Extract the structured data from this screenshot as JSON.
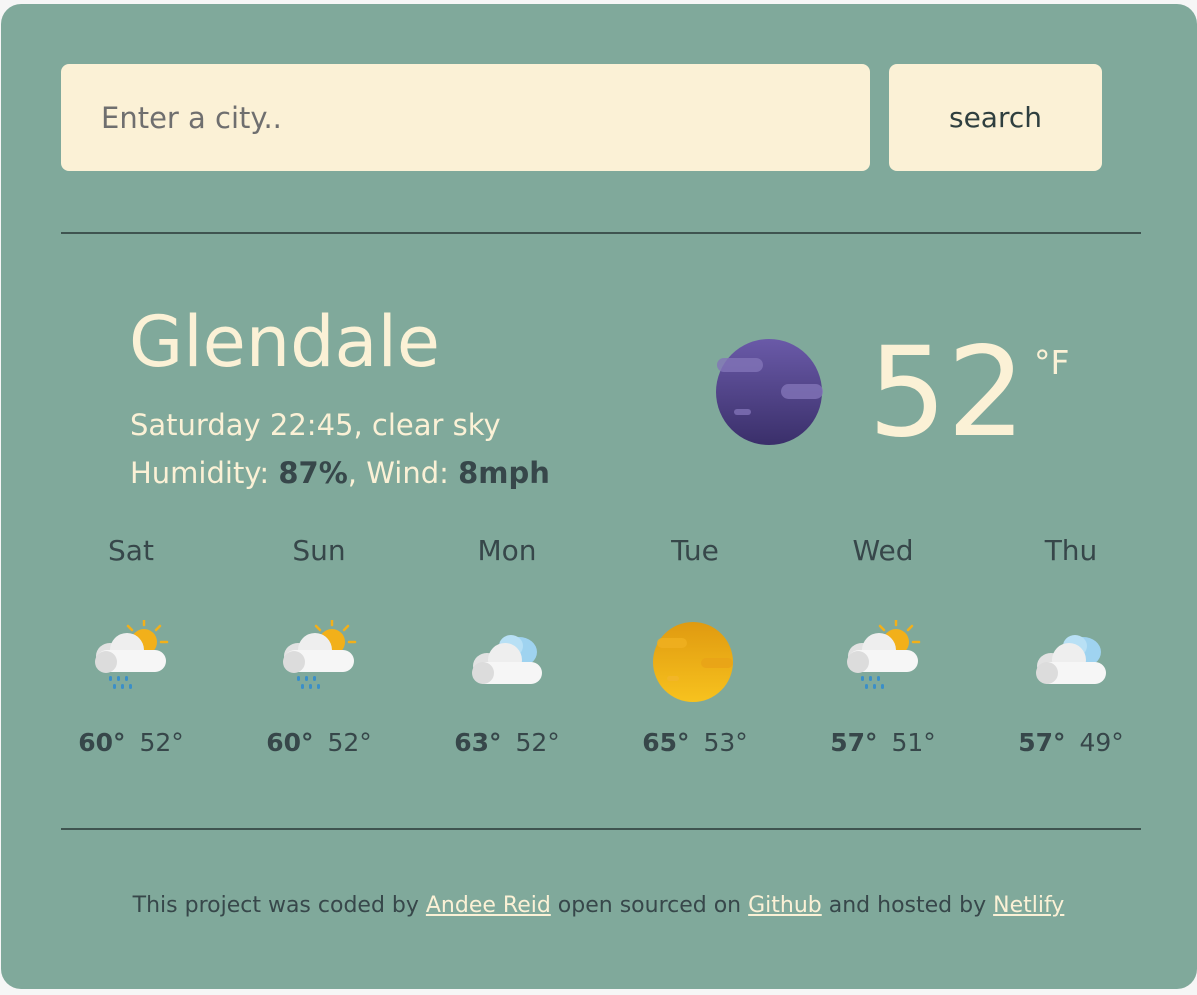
{
  "search": {
    "placeholder": "Enter a city..",
    "value": "",
    "button_label": "search"
  },
  "current": {
    "city": "Glendale",
    "datetime_description": "Saturday 22:45, clear sky",
    "humidity_label": "Humidity: ",
    "humidity_value": "87%",
    "wind_label": ", Wind: ",
    "wind_value": "8mph",
    "temperature": "52",
    "unit": "°F",
    "icon": "clear-night-icon"
  },
  "forecast": [
    {
      "day": "Sat",
      "max": "60°",
      "min": "52°",
      "icon": "sun-cloud-rain-icon"
    },
    {
      "day": "Sun",
      "max": "60°",
      "min": "52°",
      "icon": "sun-cloud-rain-icon"
    },
    {
      "day": "Mon",
      "max": "63°",
      "min": "52°",
      "icon": "cloudy-icon"
    },
    {
      "day": "Tue",
      "max": "65°",
      "min": "53°",
      "icon": "sun-icon"
    },
    {
      "day": "Wed",
      "max": "57°",
      "min": "51°",
      "icon": "sun-cloud-rain-icon"
    },
    {
      "day": "Thu",
      "max": "57°",
      "min": "49°",
      "icon": "cloudy-icon"
    }
  ],
  "footer": {
    "text_1": "This project was coded by ",
    "author_link": "Andee Reid",
    "text_2": " open sourced on ",
    "github_link": "Github",
    "text_3": " and hosted by ",
    "netlify_link": "Netlify"
  },
  "colors": {
    "background": "#80a99b",
    "cream": "#fbf1d6",
    "dark_text": "#37474a"
  }
}
